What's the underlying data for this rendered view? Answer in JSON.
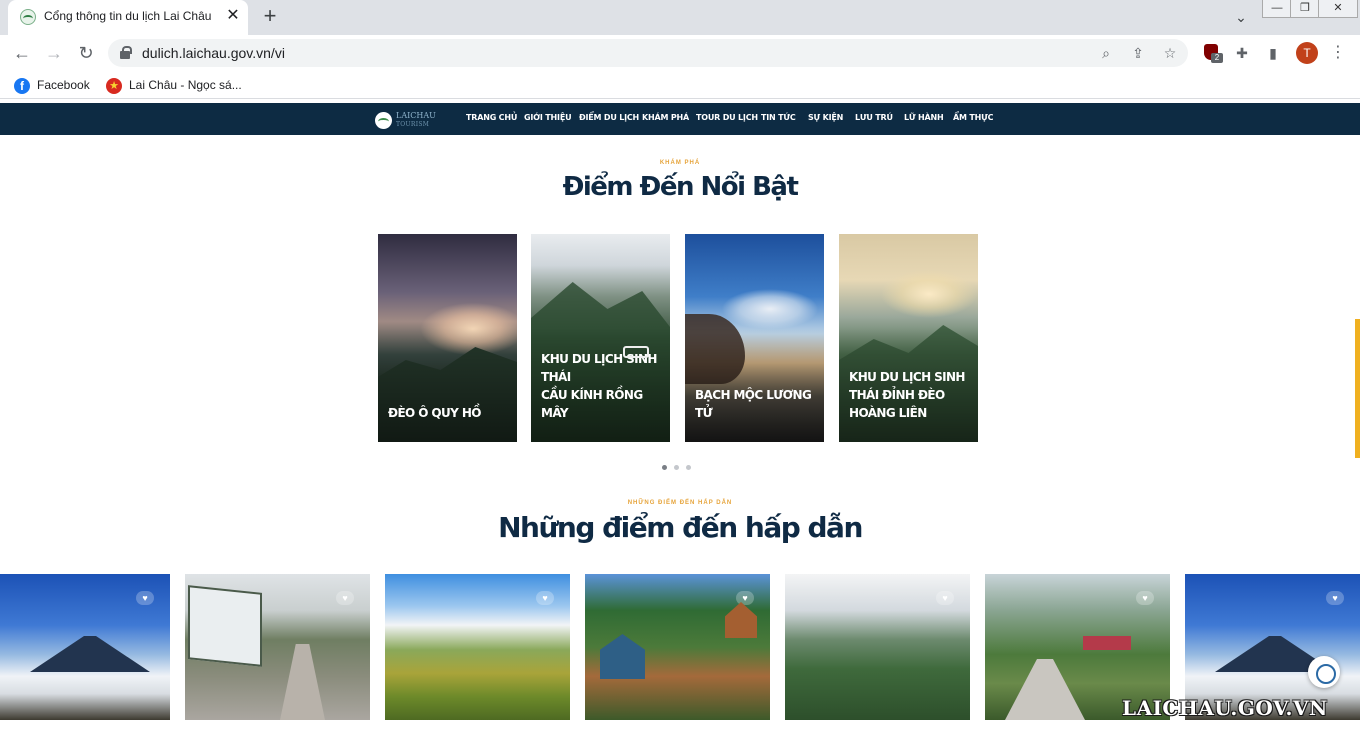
{
  "browser": {
    "tab_title": "Cổng thông tin du lịch Lai Châu",
    "tab_close": "✕",
    "new_tab": "+",
    "tab_search": "⌄",
    "window": {
      "minimize": "—",
      "maximize": "❐",
      "close": "✕"
    },
    "url": "dulich.laichau.gov.vn/vi",
    "ublock_badge": "2",
    "avatar_letter": "T",
    "bookmarks": [
      {
        "label": "Facebook",
        "icon": "facebook-icon"
      },
      {
        "label": "Lai Châu - Ngọc sá...",
        "icon": "national-emblem-icon"
      }
    ],
    "icons": {
      "back": "←",
      "forward": "→",
      "reload": "↻",
      "zoom": "⌕",
      "share": "⇪",
      "star": "☆",
      "puzzle": "✚",
      "side_panel": "▮",
      "menu": "⋮"
    }
  },
  "site": {
    "logo": {
      "name": "LAICHAU",
      "sub": "TOURISM"
    },
    "menu": [
      "TRANG CHỦ",
      "GIỚI THIỆU",
      "ĐIỂM DU LỊCH",
      "KHÁM PHÁ",
      "TOUR DU LỊCH",
      "TIN TỨC",
      "SỰ KIỆN",
      "LƯU TRÚ",
      "LỮ HÀNH",
      "ẨM THỰC"
    ],
    "featured": {
      "kicker": "KHÁM PHÁ",
      "title": "Điểm Đến Nổi Bật",
      "cards": [
        {
          "caption": "ĐÈO Ô QUY HỒ"
        },
        {
          "caption": "KHU DU LỊCH SINH\nTHÁI\nCẦU KÍNH RỒNG MÂY"
        },
        {
          "caption": "BẠCH MỘC LƯƠNG\nTỬ"
        },
        {
          "caption": "KHU DU LỊCH SINH\nTHÁI ĐỈNH ĐÈO\nHOÀNG LIÊN"
        }
      ],
      "carousel": {
        "pages": 3,
        "active": 1
      }
    },
    "attractive": {
      "kicker": "NHỮNG ĐIỂM ĐẾN HẤP DẪN",
      "title": "Những điểm đến hấp dẫn",
      "like_icon": "♥"
    },
    "watermark": "LAICHAU.GOV.VN"
  },
  "colors": {
    "nav_bg": "#0d2b43",
    "accent": "#e6a43b",
    "title": "#0f2a44",
    "scroll_accent": "#f0b020"
  }
}
